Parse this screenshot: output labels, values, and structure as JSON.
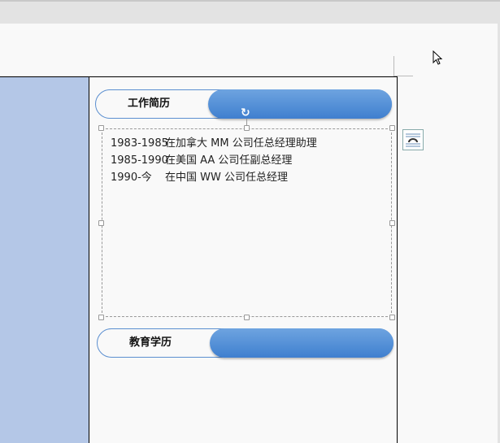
{
  "sections": [
    {
      "title": "工作简历",
      "entries": [
        {
          "years": "1983-1985",
          "text": "在加拿大 MM 公司任总经理助理"
        },
        {
          "years": "1985-1990",
          "text": "在美国 AA 公司任副总经理"
        },
        {
          "years": "1990-今",
          "text": "在中国 WW 公司任总经理"
        }
      ]
    },
    {
      "title": "教育学历"
    }
  ],
  "colors": {
    "sidebar": "#b4c7e7",
    "accent": "#4a88d6"
  }
}
